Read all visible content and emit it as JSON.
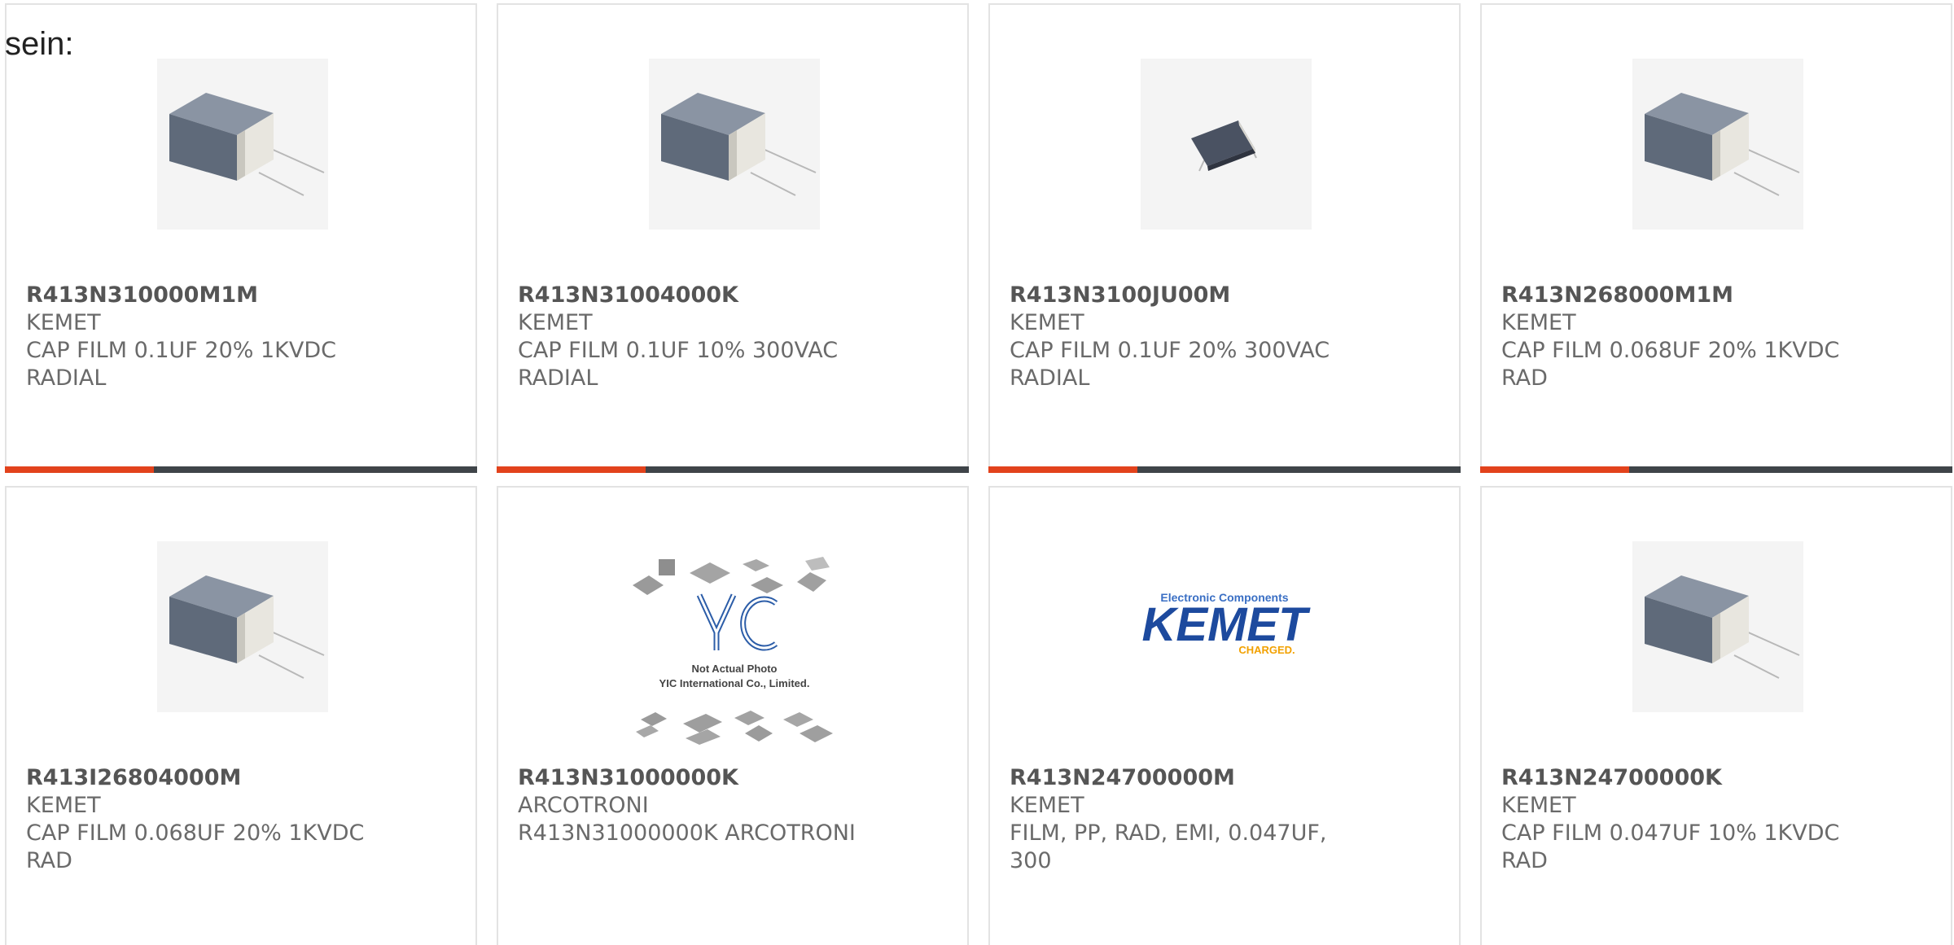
{
  "intro": {
    "text": "sein:"
  },
  "colors": {
    "accent": "#e2421c",
    "bar": "#3f4449",
    "border": "#e3e3e3",
    "text": "#6a6a6a"
  },
  "products": [
    {
      "part_number": "R413N310000M1M",
      "manufacturer": "KEMET",
      "desc_line1": "CAP FILM 0.1UF 20% 1KVDC",
      "desc_line2": "RADIAL",
      "image": "capacitor-photo"
    },
    {
      "part_number": "R413N31004000K",
      "manufacturer": "KEMET",
      "desc_line1": "CAP FILM 0.1UF 10% 300VAC",
      "desc_line2": "RADIAL",
      "image": "capacitor-photo"
    },
    {
      "part_number": "R413N3100JU00M",
      "manufacturer": "KEMET",
      "desc_line1": "CAP FILM 0.1UF 20% 300VAC",
      "desc_line2": "RADIAL",
      "image": "small-capacitor-photo"
    },
    {
      "part_number": "R413N268000M1M",
      "manufacturer": "KEMET",
      "desc_line1": "CAP FILM 0.068UF 20% 1KVDC",
      "desc_line2": "RAD",
      "image": "capacitor-photo"
    },
    {
      "part_number": "R413I26804000M",
      "manufacturer": "KEMET",
      "desc_line1": "CAP FILM 0.068UF 20% 1KVDC",
      "desc_line2": "RAD",
      "image": "capacitor-photo"
    },
    {
      "part_number": "R413N31000000K",
      "manufacturer": "ARCOTRONI",
      "desc_line1": "R413N31000000K ARCOTRONI",
      "desc_line2": "",
      "image": "yic-placeholder",
      "image_caption_1": "Not Actual Photo",
      "image_caption_2": "YIC International Co., Limited."
    },
    {
      "part_number": "R413N24700000M",
      "manufacturer": "KEMET",
      "desc_line1": "FILM, PP, RAD, EMI, 0.047UF,",
      "desc_line2": "300",
      "image": "kemet-logo",
      "logo_top": "Electronic Components",
      "logo_main": "KEMET",
      "logo_sub": "CHARGED."
    },
    {
      "part_number": "R413N24700000K",
      "manufacturer": "KEMET",
      "desc_line1": "CAP FILM 0.047UF 10% 1KVDC",
      "desc_line2": "RAD",
      "image": "capacitor-photo"
    }
  ]
}
